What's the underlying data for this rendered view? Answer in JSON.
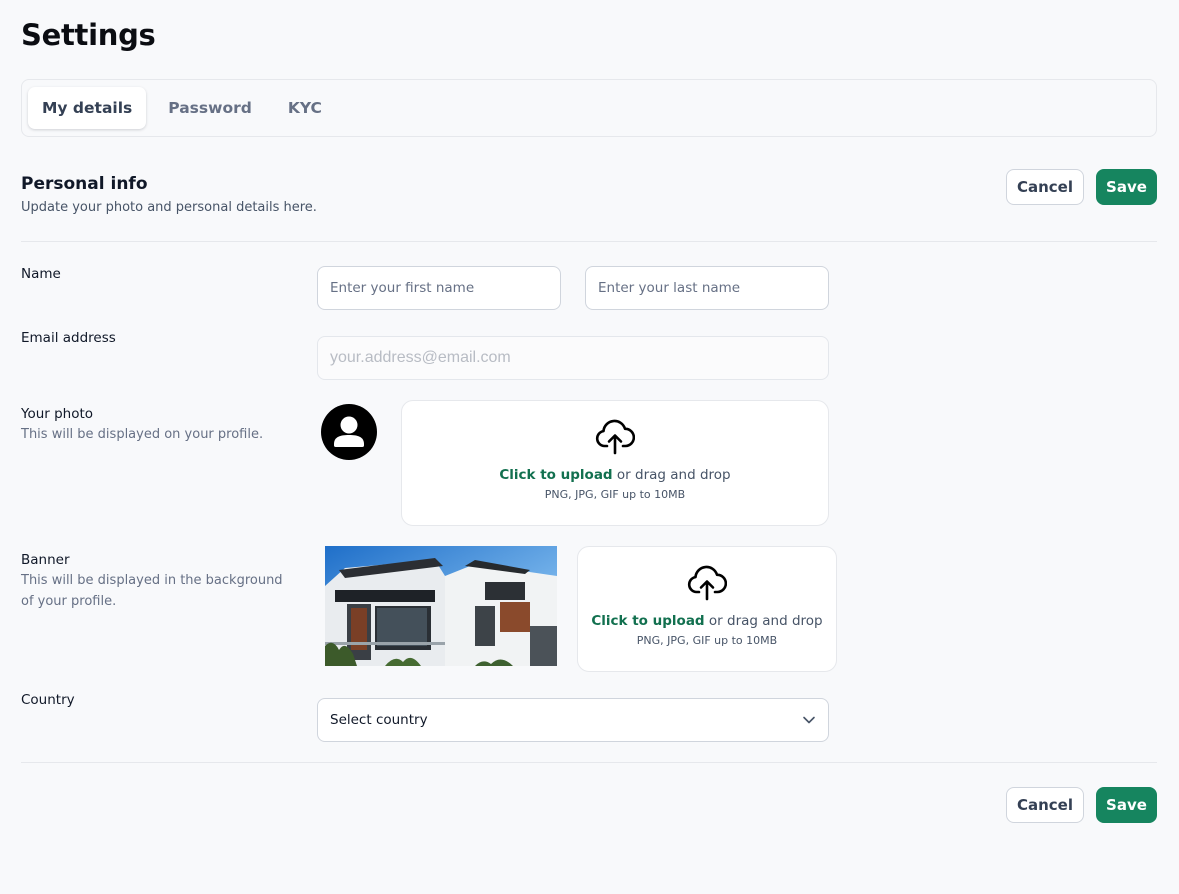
{
  "page": {
    "title": "Settings"
  },
  "tabs": [
    {
      "label": "My details",
      "active": true
    },
    {
      "label": "Password",
      "active": false
    },
    {
      "label": "KYC",
      "active": false
    }
  ],
  "section": {
    "title": "Personal info",
    "subtitle": "Update your photo and personal details here."
  },
  "actions": {
    "cancel_label": "Cancel",
    "save_label": "Save"
  },
  "fields": {
    "name": {
      "label": "Name",
      "first_placeholder": "Enter your first name",
      "last_placeholder": "Enter your last name",
      "first_value": "",
      "last_value": ""
    },
    "email": {
      "label": "Email address",
      "placeholder": "your.address@email.com",
      "value": ""
    },
    "photo": {
      "label": "Your photo",
      "hint": "This will be displayed on your profile.",
      "avatar_icon": "user-circle-icon"
    },
    "banner": {
      "label": "Banner",
      "hint": "This will be displayed in the background of your profile."
    },
    "country": {
      "label": "Country",
      "selected": "Select country",
      "icon": "chevron-down-icon"
    }
  },
  "upload": {
    "link_text": "Click to upload",
    "rest_text": " or drag and drop",
    "types": "PNG, JPG, GIF up to 10MB",
    "icon": "cloud-upload-icon"
  },
  "colors": {
    "accent": "#16855f",
    "accent_text": "#12704f",
    "background": "#f8f9fb",
    "border": "#d0d5dd"
  }
}
